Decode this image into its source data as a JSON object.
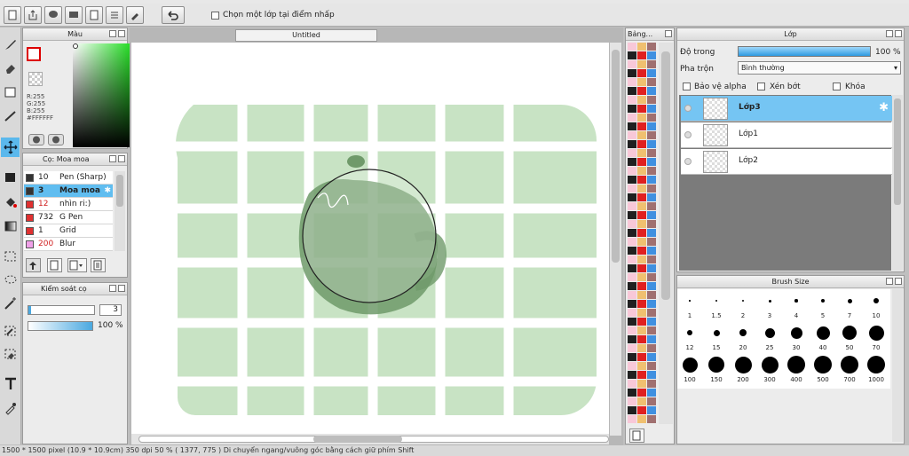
{
  "toolbar": {
    "pick_layer_label": "Chọn một lớp tại điểm nhấp"
  },
  "color_panel": {
    "title": "Màu",
    "r": "R:255",
    "g": "G:255",
    "b": "B:255",
    "hex": "#FFFFFF"
  },
  "brush_panel": {
    "title": "Cọ: Moa moa",
    "items": [
      {
        "size": "10",
        "name": "Pen (Sharp)",
        "color": "#333333"
      },
      {
        "size": "3",
        "name": "Moa moa",
        "color": "#333333"
      },
      {
        "size": "12",
        "name": "nhìn ri:)",
        "color": "#e03030"
      },
      {
        "size": "732",
        "name": "G Pen",
        "color": "#e03030"
      },
      {
        "size": "1",
        "name": "Grid",
        "color": "#e03030"
      },
      {
        "size": "200",
        "name": "Blur",
        "color": "#f0a0e8"
      }
    ]
  },
  "brush_control": {
    "title": "Kiểm soát cọ",
    "size_value": "3",
    "opacity_value": "100 %"
  },
  "canvas": {
    "tab_title": "Untitled"
  },
  "swatch_panel": {
    "title": "Bảng..."
  },
  "layer_panel": {
    "title": "Lớp",
    "opacity_label": "Độ trong",
    "opacity_value": "100 %",
    "blend_label": "Pha trộn",
    "blend_value": "Bình thường",
    "protect_alpha": "Bảo vệ alpha",
    "clipping": "Xén bớt",
    "lock": "Khóa",
    "layers": [
      {
        "name": "Lớp3",
        "selected": true
      },
      {
        "name": "Lớp1",
        "selected": false
      },
      {
        "name": "Lớp2",
        "selected": false
      }
    ]
  },
  "brush_size": {
    "title": "Brush Size",
    "labels": [
      "1",
      "1.5",
      "2",
      "3",
      "4",
      "5",
      "7",
      "10",
      "12",
      "15",
      "20",
      "25",
      "30",
      "40",
      "50",
      "70",
      "100",
      "150",
      "200",
      "300",
      "400",
      "500",
      "700",
      "1000"
    ]
  },
  "status": {
    "text": "1500 * 1500 pixel   (10.9 * 10.9cm)   350 dpi   50 %   ( 1377, 775 )   Di chuyển ngang/vuông góc bằng cách giữ phím Shift"
  }
}
